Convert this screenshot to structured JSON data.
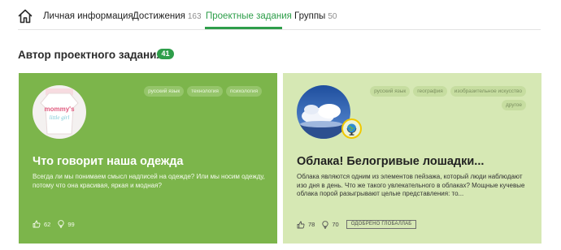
{
  "nav": {
    "tabs": [
      {
        "label": "Личная информация",
        "count": ""
      },
      {
        "label": "Достижения",
        "count": "163"
      },
      {
        "label": "Проектные задания",
        "count": ""
      },
      {
        "label": "Группы",
        "count": "50"
      }
    ],
    "active_color": "#2e9e4a"
  },
  "section": {
    "title": "Автор проектного задания",
    "count": "41"
  },
  "cards": [
    {
      "title": "Что говорит наша одежда",
      "description": "Всегда ли мы понимаем смысл надписей на одежде? Или мы носим одежду, потому что она красивая, яркая и модная?",
      "tags": [
        "русский язык",
        "технология",
        "психология"
      ],
      "likes": "62",
      "views": "99",
      "avatar_text": "mommy's little girl",
      "background": "#7cb54b"
    },
    {
      "title": "Облака! Белогривые лошадки...",
      "description": "Облака являются одним из элементов пейзажа, который люди наблюдают изо дня в день. Что же такого увлекательного в облаках? Мощные кучевые облака порой разыгрывают целые представления: то...",
      "tags": [
        "русский язык",
        "география",
        "изобразительное искусство",
        "другое"
      ],
      "likes": "78",
      "views": "70",
      "approved": "ОДОБРЕНО ГЛОБАЛЛАБ",
      "background": "#d6e8b4"
    }
  ]
}
